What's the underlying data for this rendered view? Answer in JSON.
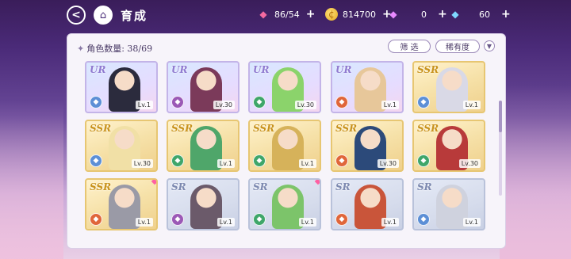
{
  "header": {
    "title": "育成",
    "back_icon": "back-arrow-icon",
    "home_icon": "castle-icon"
  },
  "resources": [
    {
      "id": "candy",
      "icon": "candy-icon",
      "value": "86/54"
    },
    {
      "id": "coin",
      "icon": "coin-icon",
      "value": "814700"
    },
    {
      "id": "gem-pink",
      "icon": "pink-gem-icon",
      "value": "0"
    },
    {
      "id": "gem-blue",
      "icon": "blue-gem-icon",
      "value": "60"
    }
  ],
  "panel": {
    "count_label": "角色数量: 38/69",
    "filter_label": "筛 选",
    "rarity_label": "稀有度",
    "sort_icon": "chevron-down-icon"
  },
  "cards": [
    {
      "rarity": "UR",
      "level": "Lv.1",
      "attr": "#5c8fd6",
      "portrait": "#2b2b3d"
    },
    {
      "rarity": "UR",
      "level": "Lv.30",
      "attr": "#9b59b6",
      "portrait": "#7b3a5a"
    },
    {
      "rarity": "UR",
      "level": "Lv.30",
      "attr": "#3fa66a",
      "portrait": "#8bd36b"
    },
    {
      "rarity": "UR",
      "level": "Lv.1",
      "attr": "#e0663a",
      "portrait": "#e7c79a"
    },
    {
      "rarity": "SSR",
      "level": "Lv.1",
      "attr": "#5c8fd6",
      "portrait": "#d9d9e6"
    },
    {
      "rarity": "SSR",
      "level": "Lv.30",
      "attr": "#5c8fd6",
      "portrait": "#f1e0a6"
    },
    {
      "rarity": "SSR",
      "level": "Lv.1",
      "attr": "#3fa66a",
      "portrait": "#4fa66a"
    },
    {
      "rarity": "SSR",
      "level": "Lv.1",
      "attr": "#3fa66a",
      "portrait": "#d6b25a"
    },
    {
      "rarity": "SSR",
      "level": "Lv.30",
      "attr": "#e0663a",
      "portrait": "#2c4a7a"
    },
    {
      "rarity": "SSR",
      "level": "Lv.30",
      "attr": "#3fa66a",
      "portrait": "#b83a3a"
    },
    {
      "rarity": "SSR",
      "level": "Lv.1",
      "attr": "#e0663a",
      "portrait": "#9a9aa6",
      "new": true
    },
    {
      "rarity": "SR",
      "level": "Lv.1",
      "attr": "#9b59b6",
      "portrait": "#6b5a6a"
    },
    {
      "rarity": "SR",
      "level": "Lv.1",
      "attr": "#3fa66a",
      "portrait": "#7cc46a",
      "new": true
    },
    {
      "rarity": "SR",
      "level": "Lv.1",
      "attr": "#e0663a",
      "portrait": "#c9553a"
    },
    {
      "rarity": "SR",
      "level": "Lv.1",
      "attr": "#5c8fd6",
      "portrait": "#cfd2de"
    }
  ]
}
